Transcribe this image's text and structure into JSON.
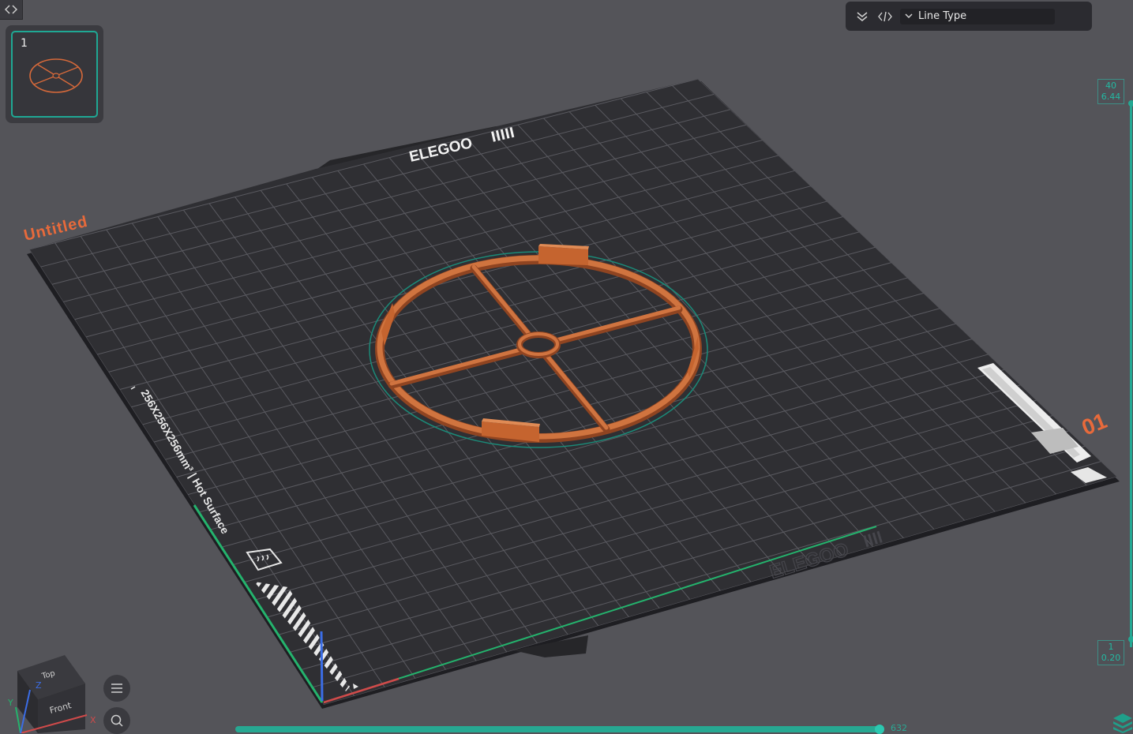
{
  "app": {
    "plate_label": "Untitled",
    "plate_index_label": "01",
    "plate_size_label": "256X256X256mm³ | Hot Surface",
    "brand_text_top": "ELEGOO",
    "brand_text_front": "ELEGOO"
  },
  "plate_list": {
    "items": [
      {
        "number": "1"
      }
    ]
  },
  "view_type": {
    "selected": "Line Type"
  },
  "layer_slider": {
    "top": {
      "layer": "40",
      "height": "6.44"
    },
    "bottom": {
      "layer": "1",
      "height": "0.20"
    }
  },
  "move_slider": {
    "value": "632"
  },
  "view_cube": {
    "top_face": "Top",
    "front_face": "Front",
    "axis_x": "X",
    "axis_y": "Y",
    "axis_z": "Z"
  },
  "colors": {
    "accent": "#1fa894",
    "print": "#c9693a",
    "plate": "#2f2f33",
    "label": "#e86a3b"
  },
  "icons": [
    "collapse-icon",
    "layers-collapse-icon",
    "code-icon",
    "chevron-down-icon",
    "menu-icon",
    "search-icon",
    "layers-stack-icon"
  ]
}
